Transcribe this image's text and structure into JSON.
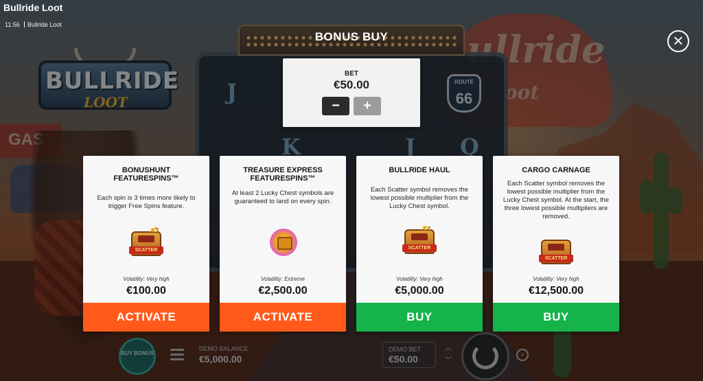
{
  "app": {
    "title": "Bullride Loot",
    "status_time": "11:56",
    "status_game": "Bullride Loot"
  },
  "background": {
    "logo_title": "BULLRIDE",
    "logo_subtitle": "LOOT",
    "sign_text": "ullride",
    "sign_sub": "oot",
    "gas_text": "GAS",
    "reel_symbols": [
      "J",
      "K",
      "J",
      "Q"
    ],
    "route_sign": {
      "top": "ROUTE",
      "number": "66"
    }
  },
  "bonus_buy": {
    "title": "BONUS BUY",
    "close_icon": "close-icon",
    "bet": {
      "label": "BET",
      "value": "€50.00",
      "minus_label": "−",
      "plus_label": "+"
    },
    "cards": [
      {
        "title": "BONUSHUNT FEATURESPINS™",
        "description": "Each spin is 3 times more likely to trigger Free Spins feature.",
        "icon": "scatter-truck-x3-icon",
        "icon_caption": "SCATTER",
        "icon_badge": "x3",
        "volatility": "Volatility: Very high",
        "price": "€100.00",
        "button_label": "ACTIVATE",
        "button_color": "#ff5a1a"
      },
      {
        "title": "TREASURE EXPRESS FEATURESPINS™",
        "description": "At least 2 Lucky Chest symbols are guaranteed to land on every spin.",
        "icon": "lucky-chest-icon",
        "volatility": "Volatility: Extreme",
        "price": "€2,500.00",
        "button_label": "ACTIVATE",
        "button_color": "#ff5a1a"
      },
      {
        "title": "BULLRIDE HAUL",
        "description": "Each Scatter symbol removes the lowest possible multiplier from the Lucky Chest symbol.",
        "icon": "scatter-truck-xx-icon",
        "icon_caption": "SCATTER",
        "icon_badge": "xx",
        "volatility": "Volatility: Very high",
        "price": "€5,000.00",
        "button_label": "BUY",
        "button_color": "#16b34a"
      },
      {
        "title": "CARGO CARNAGE",
        "description": "Each Scatter symbol removes the lowest possible multiplier from the Lucky Chest symbol. At the start, the three lowest possible multipliers are removed.",
        "icon": "scatter-truck-icon",
        "icon_caption": "SCATTER",
        "volatility": "Volatility: Very high",
        "price": "€12,500.00",
        "button_label": "BUY",
        "button_color": "#16b34a"
      }
    ]
  },
  "bottom_bar": {
    "buy_bonus_label": "BUY BONUS",
    "demo_balance_label": "DEMO BALANCE",
    "demo_balance_value": "€5,000.00",
    "demo_bet_label": "DEMO BET",
    "demo_bet_value": "€50.00"
  }
}
